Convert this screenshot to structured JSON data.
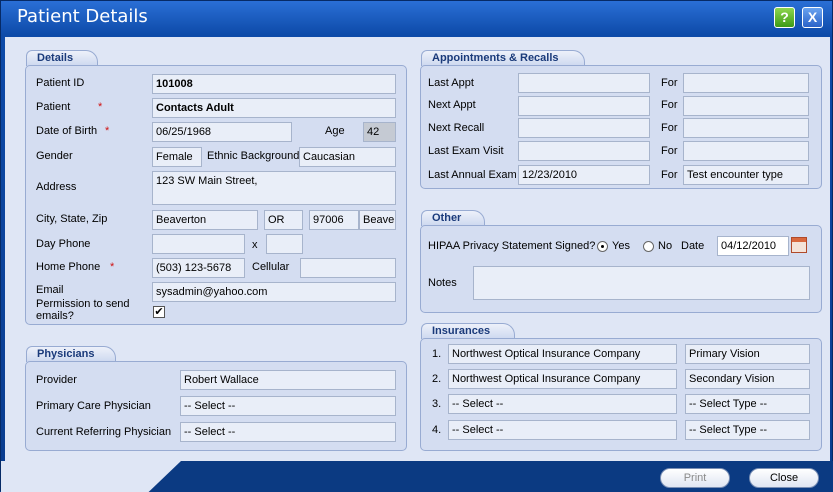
{
  "window": {
    "title": "Patient Details",
    "help": "?",
    "close": "X"
  },
  "details": {
    "tab": "Details",
    "patient_id_label": "Patient ID",
    "patient_id": "101008",
    "patient_label": "Patient",
    "patient": "Contacts Adult",
    "dob_label": "Date of Birth",
    "dob": "06/25/1968",
    "age_label": "Age",
    "age": "42",
    "gender_label": "Gender",
    "gender": "Female",
    "ethnic_label": "Ethnic Background",
    "ethnic": "Caucasian",
    "address_label": "Address",
    "address": "123 SW Main Street,",
    "csz_label": "City, State, Zip",
    "city": "Beaverton",
    "state": "OR",
    "zip": "97006",
    "county": "Beave",
    "day_phone_label": "Day Phone",
    "day_phone": "",
    "x_label": "x",
    "ext": "",
    "home_phone_label": "Home Phone",
    "home_phone": "(503) 123-5678",
    "cellular_label": "Cellular",
    "cellular": "",
    "email_label": "Email",
    "email": "sysadmin@yahoo.com",
    "permission_label": "Permission to send emails?",
    "permission_checked": "✔",
    "req": "*"
  },
  "physicians": {
    "tab": "Physicians",
    "provider_label": "Provider",
    "provider": "Robert Wallace",
    "pcp_label": "Primary Care Physician",
    "pcp": "-- Select --",
    "crp_label": "Current Referring Physician",
    "crp": "-- Select --"
  },
  "appointments": {
    "tab": "Appointments & Recalls",
    "for_label": "For",
    "rows": [
      {
        "label": "Last Appt",
        "date": "",
        "for": ""
      },
      {
        "label": "Next Appt",
        "date": "",
        "for": ""
      },
      {
        "label": "Next Recall",
        "date": "",
        "for": ""
      },
      {
        "label": "Last Exam Visit",
        "date": "",
        "for": ""
      },
      {
        "label": "Last Annual Exam",
        "date": "12/23/2010",
        "for": "Test encounter type"
      }
    ]
  },
  "other": {
    "tab": "Other",
    "hipaa_label": "HIPAA Privacy Statement Signed?",
    "yes_label": "Yes",
    "no_label": "No",
    "date_label": "Date",
    "date": "04/12/2010",
    "notes_label": "Notes",
    "notes": ""
  },
  "insurances": {
    "tab": "Insurances",
    "rows": [
      {
        "num": "1.",
        "company": "Northwest Optical Insurance Company",
        "type": "Primary Vision"
      },
      {
        "num": "2.",
        "company": "Northwest Optical Insurance Company",
        "type": "Secondary Vision"
      },
      {
        "num": "3.",
        "company": "-- Select --",
        "type": "-- Select Type --"
      },
      {
        "num": "4.",
        "company": "-- Select --",
        "type": "-- Select Type --"
      }
    ]
  },
  "buttons": {
    "print": "Print",
    "close": "Close"
  }
}
